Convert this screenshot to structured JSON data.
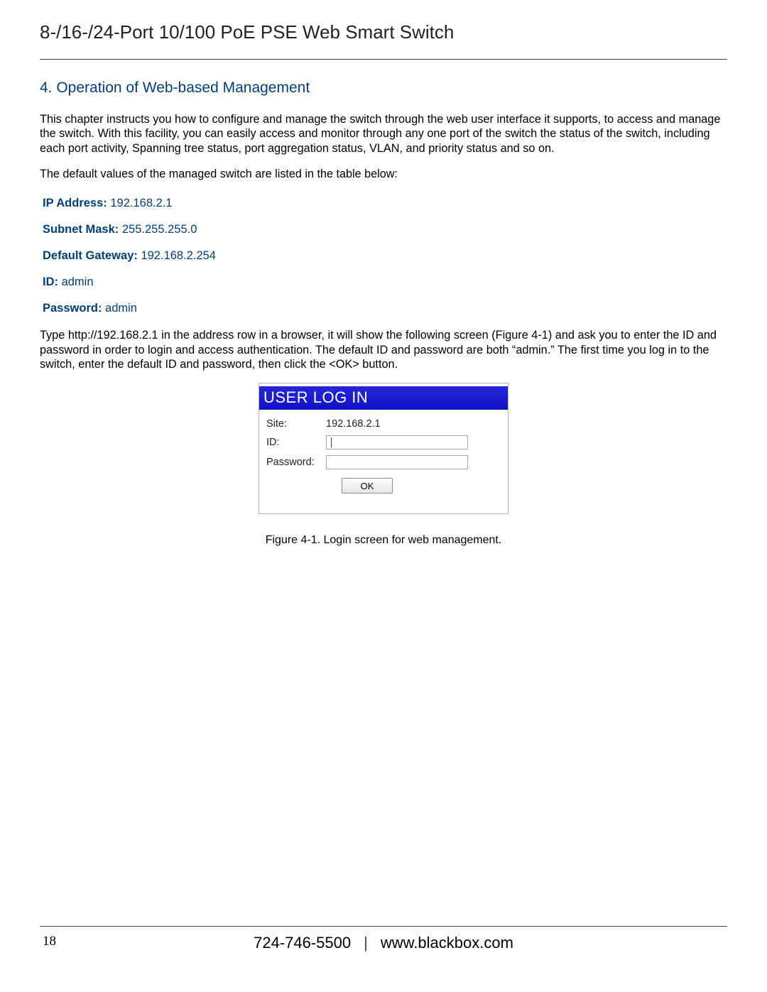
{
  "header": {
    "title": "8-/16-/24-Port 10/100 PoE PSE Web Smart Switch"
  },
  "section": {
    "heading": "4. Operation of Web-based Management"
  },
  "paragraphs": {
    "intro": "This chapter instructs you how to configure and manage the switch through the web user interface it supports, to access and manage the switch. With this facility, you can easily access and monitor through any one port of the switch the status of the switch, including each port activity, Spanning tree status, port aggregation status, VLAN, and priority status and so on.",
    "defaults_lead": "The default values of the managed switch are listed in the table below:",
    "afterDefaults": "Type http://192.168.2.1 in the address row in a browser, it will show the following screen (Figure 4-1) and ask you to enter the ID and password in order to login and access authentication. The default ID and password are both “admin.” The first time you log in to the switch, enter the default ID and password, then click the <OK> button."
  },
  "defaults": [
    {
      "key": "IP Address:",
      "value": " 192.168.2.1"
    },
    {
      "key": "Subnet Mask:",
      "value": " 255.255.255.0"
    },
    {
      "key": "Default Gateway:",
      "value": " 192.168.2.254"
    },
    {
      "key": "ID:",
      "value": " admin"
    },
    {
      "key": "Password:",
      "value": " admin"
    }
  ],
  "login": {
    "title": "USER LOG IN",
    "siteLabel": "Site:",
    "siteValue": "192.168.2.1",
    "idLabel": "ID:",
    "idValue": "",
    "passwordLabel": "Password:",
    "passwordValue": "",
    "okLabel": "OK"
  },
  "figure": {
    "caption": "Figure 4-1. Login screen for web management."
  },
  "footer": {
    "pageNumber": "18",
    "phone": "724-746-5500",
    "separator": "|",
    "url": "www.blackbox.com"
  }
}
